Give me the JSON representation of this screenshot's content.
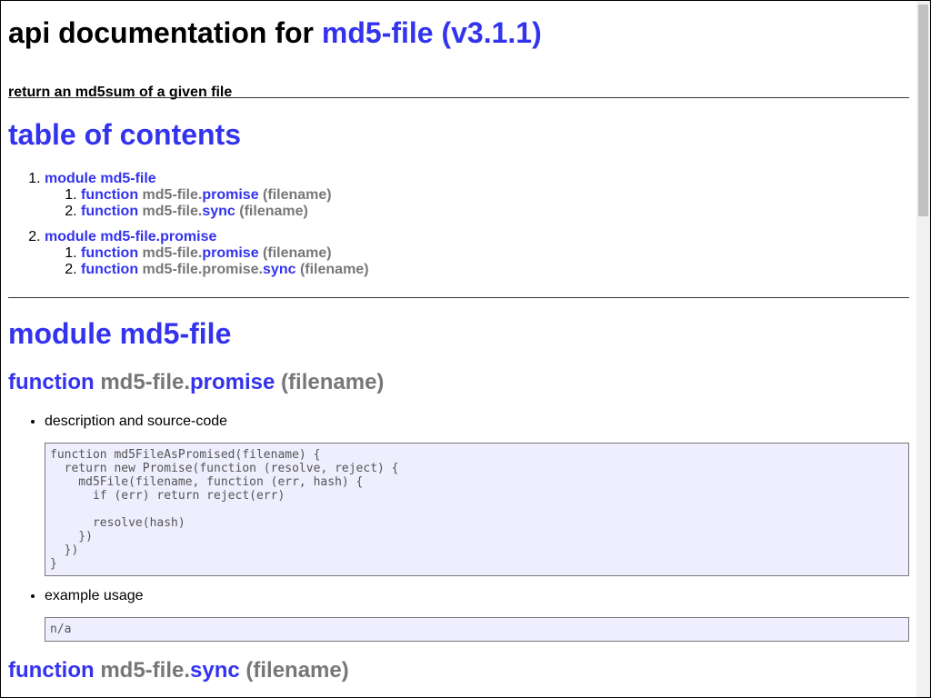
{
  "header": {
    "title_prefix": "api documentation for",
    "title_link": "md5-file (v3.1.1)",
    "tagline": "return an md5sum of a given file"
  },
  "toc": {
    "heading": "table of contents",
    "modules": [
      {
        "label": "module md5-file",
        "functions": [
          {
            "kw": "function",
            "prefix": "md5-file.",
            "name": "promise",
            "args": "(filename)"
          },
          {
            "kw": "function",
            "prefix": "md5-file.",
            "name": "sync",
            "args": "(filename)"
          }
        ]
      },
      {
        "label": "module md5-file.promise",
        "functions": [
          {
            "kw": "function",
            "prefix": "md5-file.",
            "name": "promise",
            "args": "(filename)"
          },
          {
            "kw": "function",
            "prefix": "md5-file.promise.",
            "name": "sync",
            "args": "(filename)"
          }
        ]
      }
    ]
  },
  "module_section": {
    "heading": "module md5-file",
    "functions": [
      {
        "kw": "function",
        "prefix": "md5-file.",
        "name": "promise",
        "args": "(filename)",
        "desc_label": "description and source-code",
        "source": "function md5FileAsPromised(filename) {\n  return new Promise(function (resolve, reject) {\n    md5File(filename, function (err, hash) {\n      if (err) return reject(err)\n\n      resolve(hash)\n    })\n  })\n}",
        "example_label": "example usage",
        "example": "n/a"
      },
      {
        "kw": "function",
        "prefix": "md5-file.",
        "name": "sync",
        "args": "(filename)"
      }
    ]
  },
  "colors": {
    "link": "#3333ee",
    "muted": "#777777",
    "code_bg": "#eeeeff"
  }
}
